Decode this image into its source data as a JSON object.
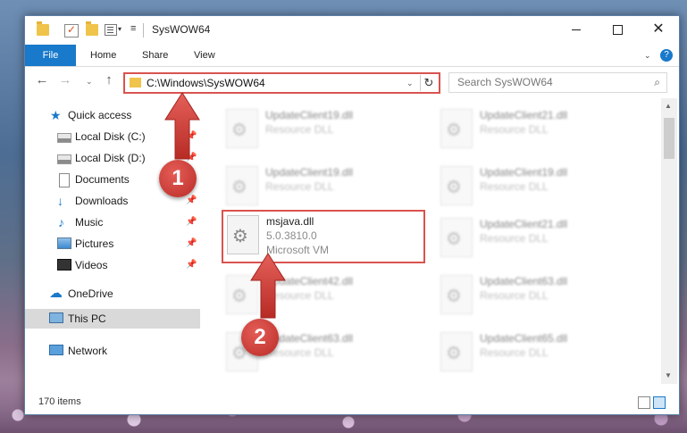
{
  "window": {
    "title": "SysWOW64",
    "controls": {
      "minimize": "",
      "maximize": "",
      "close": "✕"
    }
  },
  "ribbon": {
    "file": "File",
    "tabs": [
      "Home",
      "Share",
      "View"
    ],
    "help": "?"
  },
  "nav": {
    "back": "←",
    "forward": "→",
    "recent": "⌄",
    "up": "↑",
    "address": "C:\\Windows\\SysWOW64",
    "refresh": "↻",
    "search_placeholder": "Search SysWOW64"
  },
  "sidebar": {
    "items": [
      {
        "label": "Quick access",
        "icon": "star-icon",
        "pinned": false
      },
      {
        "label": "Local Disk (C:)",
        "icon": "disk-icon",
        "pinned": true
      },
      {
        "label": "Local Disk (D:)",
        "icon": "disk-icon",
        "pinned": true
      },
      {
        "label": "Documents",
        "icon": "documents-icon",
        "pinned": true
      },
      {
        "label": "Downloads",
        "icon": "download-icon",
        "pinned": true
      },
      {
        "label": "Music",
        "icon": "music-icon",
        "pinned": true
      },
      {
        "label": "Pictures",
        "icon": "pictures-icon",
        "pinned": true
      },
      {
        "label": "Videos",
        "icon": "videos-icon",
        "pinned": true
      },
      {
        "label": "OneDrive",
        "icon": "cloud-icon",
        "pinned": false
      },
      {
        "label": "This PC",
        "icon": "pc-icon",
        "pinned": false,
        "selected": true
      },
      {
        "label": "Network",
        "icon": "network-icon",
        "pinned": false
      }
    ]
  },
  "files": {
    "left": [
      {
        "name": "UpdateClient19.dll",
        "type": "Resource DLL"
      },
      {
        "name": "UpdateClient19.dll",
        "type": "Resource DLL"
      },
      {
        "name": "msjava.dll",
        "version": "5.0.3810.0",
        "company": "Microsoft VM"
      },
      {
        "name": "UpdateClient42.dll",
        "type": "Resource DLL"
      },
      {
        "name": "UpdateClient63.dll",
        "type": "Resource DLL"
      }
    ],
    "right": [
      {
        "name": "UpdateClient21.dll",
        "type": "Resource DLL"
      },
      {
        "name": "UpdateClient19.dll",
        "type": "Resource DLL"
      },
      {
        "name": "UpdateClient21.dll",
        "type": "Resource DLL"
      },
      {
        "name": "UpdateClient63.dll",
        "type": "Resource DLL"
      },
      {
        "name": "UpdateClient65.dll",
        "type": "Resource DLL"
      }
    ]
  },
  "status": {
    "items": "170 items"
  },
  "annotations": {
    "step1": "1",
    "step2": "2",
    "color": "#d9534f"
  }
}
